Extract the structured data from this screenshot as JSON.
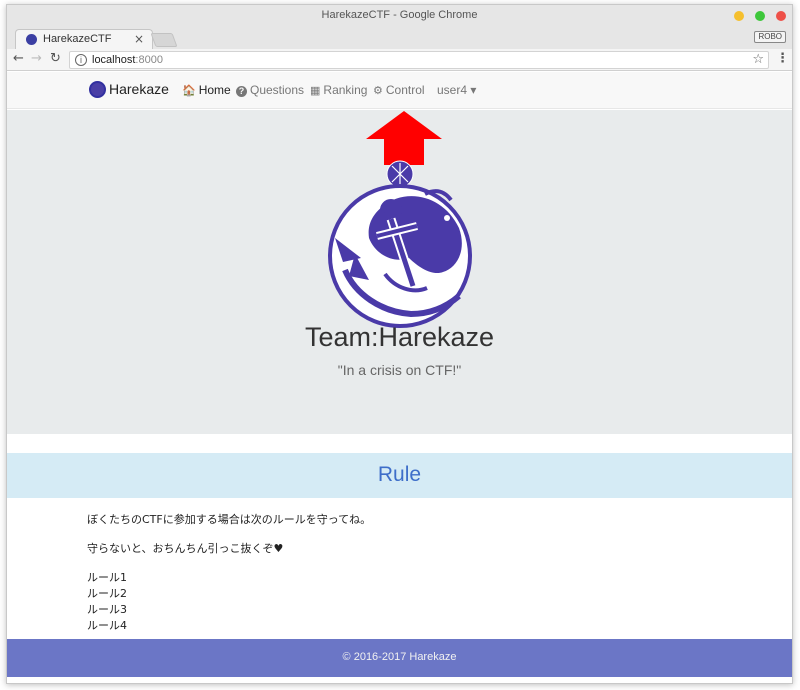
{
  "window": {
    "title": "HarekazeCTF - Google Chrome"
  },
  "tab": {
    "title": "HarekazeCTF",
    "close": "×"
  },
  "profile_badge": "ROBO",
  "address_bar": {
    "host": "localhost",
    "port": ":8000"
  },
  "navbar": {
    "brand": "Harekaze",
    "items": [
      {
        "icon": "home-icon",
        "glyph": "🏠",
        "label": "Home",
        "active": true
      },
      {
        "icon": "question-circle-icon",
        "glyph": "?",
        "label": "Questions",
        "active": false
      },
      {
        "icon": "table-icon",
        "glyph": "▦",
        "label": "Ranking",
        "active": false
      },
      {
        "icon": "cogs-icon",
        "glyph": "⚙",
        "label": "Control",
        "active": false
      }
    ],
    "user": {
      "label": "user4",
      "caret": "▾"
    }
  },
  "jumbotron": {
    "title": "Team:Harekaze",
    "subtitle": "\"In a crisis on CTF!\""
  },
  "rule": {
    "heading": "Rule",
    "paragraphs": [
      "ぼくたちのCTFに参加する場合は次のルールを守ってね。",
      "守らないと、おちんちん引っこ抜くぞ♥"
    ],
    "list": [
      "ルール1",
      "ルール2",
      "ルール3",
      "ルール4"
    ]
  },
  "footer": {
    "text": "© 2016-2017 Harekaze"
  },
  "colors": {
    "accent_arrow": "#ff0000",
    "logo_purple": "#4a3aa8",
    "rule_heading": "#3e6ec9",
    "footer_bg": "#6b76c6",
    "jumbotron_bg": "#e8ebec"
  }
}
